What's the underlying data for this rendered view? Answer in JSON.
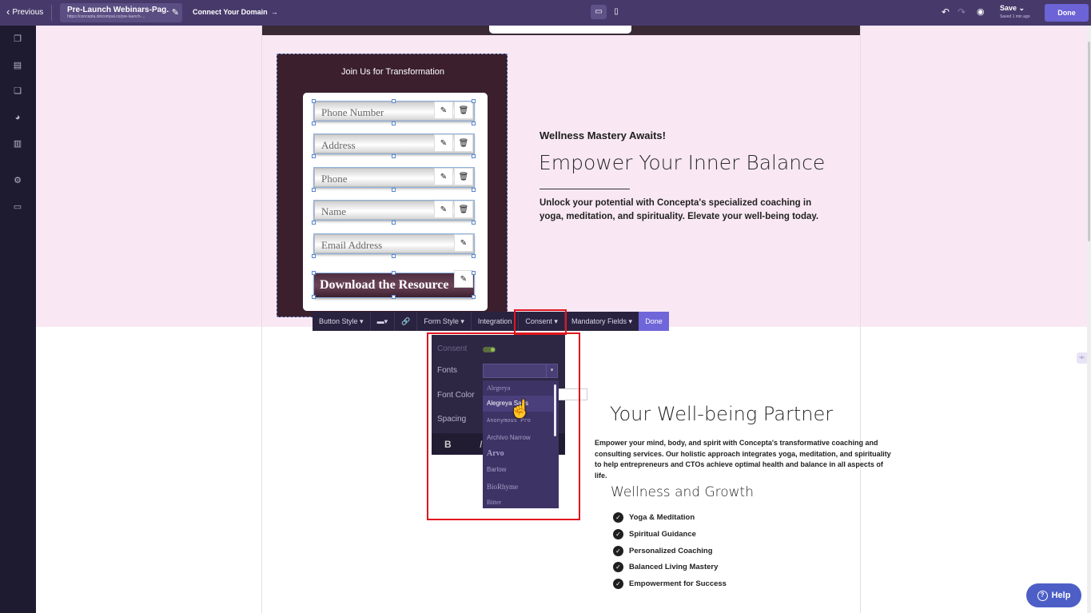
{
  "topbar": {
    "previous_label": "Previous",
    "page_title": "Pre-Launch Webinars-Pag...",
    "page_url": "https://concepta.dotcompal.co/pre-launch-...",
    "connect_domain_label": "Connect Your Domain",
    "save_label": "Save",
    "saved_status": "Saved 1 min ago",
    "done_label": "Done"
  },
  "sidebar": {
    "items": [
      {
        "icon": "layers-icon"
      },
      {
        "icon": "sections-icon"
      },
      {
        "icon": "pages-icon"
      },
      {
        "icon": "palette-icon"
      },
      {
        "icon": "clipboard-icon"
      },
      {
        "icon": "gear-icon"
      },
      {
        "icon": "monitor-icon"
      }
    ]
  },
  "form": {
    "title": "Join Us for Transformation",
    "fields": [
      {
        "placeholder": "Phone Number"
      },
      {
        "placeholder": "Address"
      },
      {
        "placeholder": "Phone"
      },
      {
        "placeholder": "Name"
      },
      {
        "placeholder": "Email Address"
      }
    ],
    "submit_label": "Download the Resource"
  },
  "hero": {
    "eyebrow": "Wellness Mastery Awaits!",
    "title": "Empower Your Inner Balance",
    "body": "Unlock your potential with Concepta's specialized coaching in yoga, meditation, and spirituality. Elevate your well-being today."
  },
  "editor_toolbar": {
    "items": [
      "Button Style",
      "Form Style",
      "Integration",
      "Consent",
      "Mandatory Fields"
    ],
    "done_label": "Done"
  },
  "consent_panel": {
    "consent_label": "Consent",
    "fonts_label": "Fonts",
    "font_color_label": "Font Color",
    "spacing_label": "Spacing",
    "bold_label": "B",
    "italic_label": "I"
  },
  "font_list": {
    "options": [
      "Alegreya",
      "Alegreya Sans",
      "Anonymous Pro",
      "Archivo Narrow",
      "Arvo",
      "Barlow",
      "BioRhyme",
      "Bitter"
    ],
    "selected": "Alegreya Sans"
  },
  "section2": {
    "title": "Your Well-being Partner",
    "body": "Empower your mind, body, and spirit with Concepta's transformative coaching and consulting services. Our holistic approach integrates yoga, meditation, and spirituality to help entrepreneurs and CTOs achieve optimal health and balance in all aspects of life.",
    "subtitle": "Wellness and Growth",
    "list": [
      "Yoga & Meditation",
      "Spiritual Guidance",
      "Personalized Coaching",
      "Balanced Living Mastery",
      "Empowerment for Success"
    ]
  },
  "help_label": "Help",
  "colors": {
    "topbar": "#473a6b",
    "sidebar": "#1e1b30",
    "hero_bg": "#f9e8f4",
    "form_bg": "#3b1f2c",
    "accent": "#6c63d6",
    "highlight": "#e0161e"
  }
}
